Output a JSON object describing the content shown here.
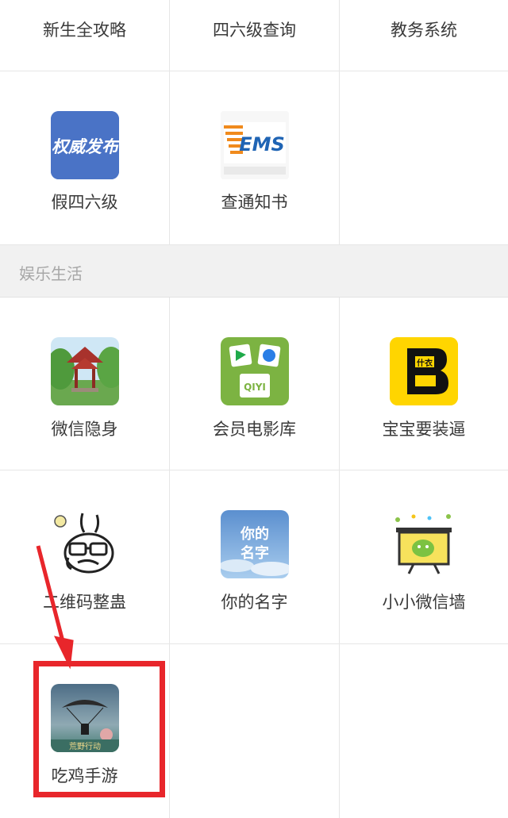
{
  "rows": {
    "row0": [
      "新生全攻略",
      "四六级查询",
      "教务系统"
    ],
    "row1": [
      "假四六级",
      "查通知书"
    ],
    "row2": [
      "微信隐身",
      "会员电影库",
      "宝宝要装逼"
    ],
    "row3": [
      "二维码整蛊",
      "你的名字",
      "小小微信墙"
    ],
    "row4": [
      "吃鸡手游"
    ]
  },
  "section": {
    "title": "娱乐生活"
  },
  "icons": {
    "authority": {
      "name": "authority-icon",
      "text": "权威发布",
      "bg": "#4a73c6"
    },
    "ems": {
      "name": "ems-icon",
      "text": "EMS"
    },
    "movie": {
      "name": "movie-library-icon",
      "bg": "#7cb342",
      "brand": "QIYI"
    },
    "zhuang": {
      "name": "zhuangbi-icon",
      "bg": "#ffd500",
      "text": "B",
      "sub": "什衣"
    },
    "name": {
      "name": "your-name-icon",
      "text": "你的名字"
    },
    "wall": {
      "name": "wechat-wall-icon"
    },
    "game": {
      "name": "pubg-mobile-icon",
      "text": "荒野行动"
    }
  },
  "colors": {
    "highlight": "#e8262b",
    "section_bg": "#f1f1f1"
  }
}
